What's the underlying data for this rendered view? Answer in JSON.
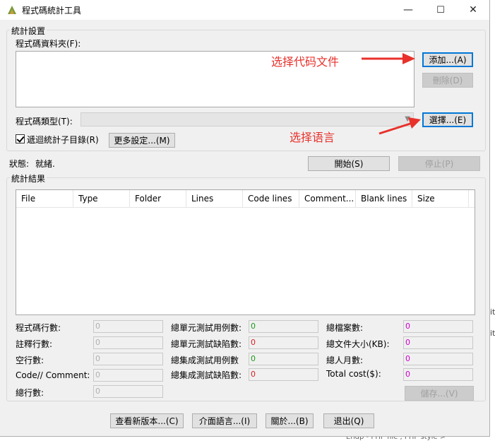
{
  "window": {
    "title": "程式碼統計工具",
    "minimize": "—",
    "maximize": "☐",
    "close": "✕"
  },
  "settings": {
    "group_label": "統計設置",
    "folder_label": "程式碼資料夾(F):",
    "add_label": "添加...(A)",
    "delete_label": "刪除(D)",
    "type_label": "程式碼類型(T):",
    "choose_label": "選擇...(E)",
    "recursive_label": "遞迴統計子目錄(R)",
    "more_label": "更多設定...(M)"
  },
  "status": {
    "label": "狀態:",
    "value": "就緒.",
    "start_label": "開始(S)",
    "stop_label": "停止(P)"
  },
  "results": {
    "group_label": "統計結果",
    "columns": [
      "File",
      "Type",
      "Folder",
      "Lines",
      "Code lines",
      "Comment...",
      "Blank lines",
      "Size"
    ]
  },
  "stats": {
    "left": [
      {
        "label": "程式碼行數:",
        "value": "0"
      },
      {
        "label": "註釋行數:",
        "value": "0"
      },
      {
        "label": "空行數:",
        "value": "0"
      },
      {
        "label": "Code// Comment:",
        "value": "0"
      },
      {
        "label": "總行數:",
        "value": "0"
      }
    ],
    "middle": [
      {
        "label": "總單元測試用例數:",
        "value": "0"
      },
      {
        "label": "總單元測試缺陷數:",
        "value": "0"
      },
      {
        "label": "總集成測試用例數",
        "value": "0"
      },
      {
        "label": "總集成測試缺陷數:",
        "value": "0"
      }
    ],
    "right": [
      {
        "label": "總檔案數:",
        "value": "0"
      },
      {
        "label": "總文件大小(KB):",
        "value": "0"
      },
      {
        "label": "總人月數:",
        "value": "0"
      },
      {
        "label": "Total cost($):",
        "value": "0"
      }
    ],
    "save_label": "儲存...(V)"
  },
  "footer": {
    "check_update": "查看新版本...(C)",
    "language": "介面語言...(I)",
    "about": "關於...(B)",
    "exit": "退出(Q)"
  },
  "annotations": {
    "choose_code_files": "选择代码文件",
    "choose_language": "选择语言"
  },
  "colors": {
    "annotation_red": "#e8312b",
    "middle_value_green": "#1a9a1a",
    "middle_value_red": "#d42020",
    "right_value_magenta": "#cc00cc",
    "focus_blue": "#0078d7"
  },
  "icons": {
    "app_icon": "app-icon",
    "checkbox": "checkmark",
    "arrow": "red-arrow"
  },
  "background_fragments": [
    "ityle",
    "ityle",
    "le",
    "Endp - PHP file , PHP style >"
  ]
}
